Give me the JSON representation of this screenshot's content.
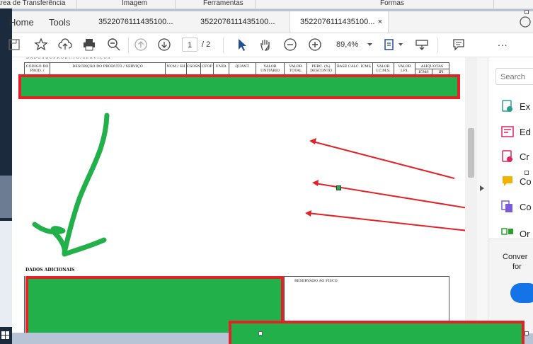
{
  "ribbon": {
    "items": [
      "Área de Transferência",
      "Imagem",
      "Ferramentas",
      "Formas"
    ]
  },
  "app": {
    "nav_home": "Home",
    "nav_tools": "Tools",
    "tabs": [
      {
        "label": "3522076111435100...",
        "active": false
      },
      {
        "label": "3522076111435100...",
        "active": false
      },
      {
        "label": "3522076111435100...",
        "active": true
      }
    ],
    "tab_close_glyph": "×"
  },
  "toolbar": {
    "page_current": "1",
    "page_total": "/ 2",
    "zoom": "89,4%",
    "more_glyph": "..."
  },
  "document": {
    "table_headers": [
      "CÓDIGO DO PROD. /",
      "DESCRIÇÃO DO PRODUTO / SERVIÇO",
      "NCM / SH",
      "CSOSN",
      "CFOP",
      "UNID.",
      "QUANT.",
      "VALOR UNITÁRIO",
      "VALOR TOTAL",
      "PERC. (%) DESCONTO",
      "BASE CÁLC. ICMS",
      "VALOR I.C.M.S.",
      "VALOR I.P.I.",
      "ALÍQUOTAS",
      "ICMS",
      "IPI"
    ],
    "section_additional": "DADOS ADICIONAIS",
    "reserved_label": "RESERVADO AO FISCO"
  },
  "right_panel": {
    "search_placeholder": "Search",
    "tools": [
      {
        "icon": "export-pdf-icon",
        "label": "Ex",
        "color": "#2a9d8f"
      },
      {
        "icon": "edit-pdf-icon",
        "label": "Ed",
        "color": "#e0245e"
      },
      {
        "icon": "create-pdf-icon",
        "label": "Cr",
        "color": "#e0245e"
      },
      {
        "icon": "comment-icon",
        "label": "Co",
        "color": "#f0b400"
      },
      {
        "icon": "combine-files-icon",
        "label": "Co",
        "color": "#7b5cd6"
      },
      {
        "icon": "organize-pages-icon",
        "label": "Or",
        "color": "#2ca02c"
      }
    ],
    "promo_text_1": "Conver",
    "promo_text_2": "for"
  },
  "colors": {
    "annotation_red": "#e32227",
    "annotation_green": "#22b04a",
    "accent_blue": "#1473e6"
  }
}
